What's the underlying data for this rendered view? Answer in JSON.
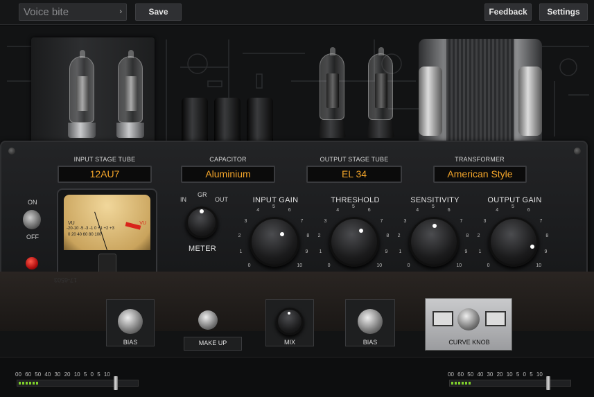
{
  "topbar": {
    "preset_name": "Voice bite",
    "preset_arrow": "›",
    "save_label": "Save",
    "feedback_label": "Feedback",
    "settings_label": "Settings"
  },
  "panel": {
    "sections": [
      {
        "label": "INPUT STAGE TUBE",
        "value": "12AU7"
      },
      {
        "label": "CAPACITOR",
        "value": "Aluminium"
      },
      {
        "label": "OUTPUT STAGE TUBE",
        "value": "EL 34"
      },
      {
        "label": "TRANSFORMER",
        "value": "American Style"
      }
    ],
    "power": {
      "on_label": "ON",
      "off_label": "OFF"
    },
    "vu": {
      "left_label": "VU",
      "right_label": "VU",
      "scale": "-20-10 -5 -3 -1 0 +1 +2 +3",
      "scale2": "0 20 40 60 80 100"
    },
    "meter": {
      "label": "METER",
      "in": "IN",
      "gr": "GR",
      "out": "OUT",
      "selected": "GR"
    },
    "knobs": [
      {
        "label": "INPUT GAIN",
        "value": 6.5
      },
      {
        "label": "THRESHOLD",
        "value": 5.5
      },
      {
        "label": "SENSITIVITY",
        "value": 5
      },
      {
        "label": "OUTPUT GAIN",
        "value": 8.5
      }
    ],
    "tick_labels": [
      "0",
      "1",
      "2",
      "3",
      "4",
      "5",
      "6",
      "7",
      "8",
      "9",
      "10"
    ]
  },
  "internals": {
    "bias_left": "BIAS",
    "make_up": "MAKE UP",
    "mix": "MIX",
    "bias_right": "BIAS",
    "curve_knob": "CURVE KNOB",
    "pcb_text": "17-6503"
  },
  "meters": {
    "scale": "00 60 50 40 30 20 10 5 0 5 10",
    "left": {
      "level": 0.17,
      "fader": 0.82
    },
    "right": {
      "level": 0.17,
      "fader": 0.82
    }
  },
  "colors": {
    "accent": "#f5a62a",
    "led_green": "#7fd12b",
    "led_red": "#d9241b"
  }
}
